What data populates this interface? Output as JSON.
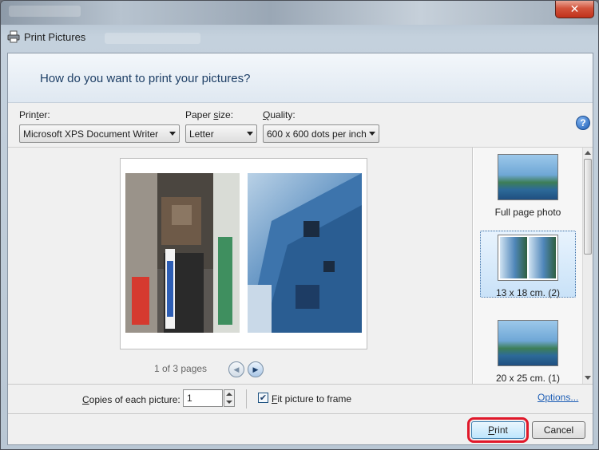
{
  "window": {
    "title": "Print Pictures",
    "close_glyph": "✕"
  },
  "header": {
    "heading": "How do you want to print your pictures?"
  },
  "settings": {
    "printer_label_pre": "Prin",
    "printer_label_key": "t",
    "printer_label_post": "er:",
    "printer_value": "Microsoft XPS Document Writer",
    "paper_label_pre": "Paper ",
    "paper_label_key": "s",
    "paper_label_post": "ize:",
    "paper_value": "Letter",
    "quality_label_key": "Q",
    "quality_label_post": "uality:",
    "quality_value": "600 x 600 dots per inch",
    "help_glyph": "?"
  },
  "preview": {
    "pager_text": "1 of 3 pages",
    "prev_glyph": "◀",
    "next_glyph": "▶"
  },
  "layouts": {
    "items": [
      {
        "label": "Full page photo"
      },
      {
        "label": "13 x 18 cm. (2)"
      },
      {
        "label": "20 x 25 cm. (1)"
      }
    ],
    "selected_index": 1
  },
  "options": {
    "copies_label_key": "C",
    "copies_label_post": "opies of each picture:",
    "copies_value": "1",
    "fit_checked_glyph": "✔",
    "fit_label_key": "F",
    "fit_label_post": "it picture to frame",
    "options_link": "Options..."
  },
  "buttons": {
    "print_key": "P",
    "print_post": "rint",
    "cancel": "Cancel"
  },
  "colors": {
    "highlight_box": "#e0182a",
    "link": "#1f5fb6",
    "heading": "#1e3f66"
  }
}
